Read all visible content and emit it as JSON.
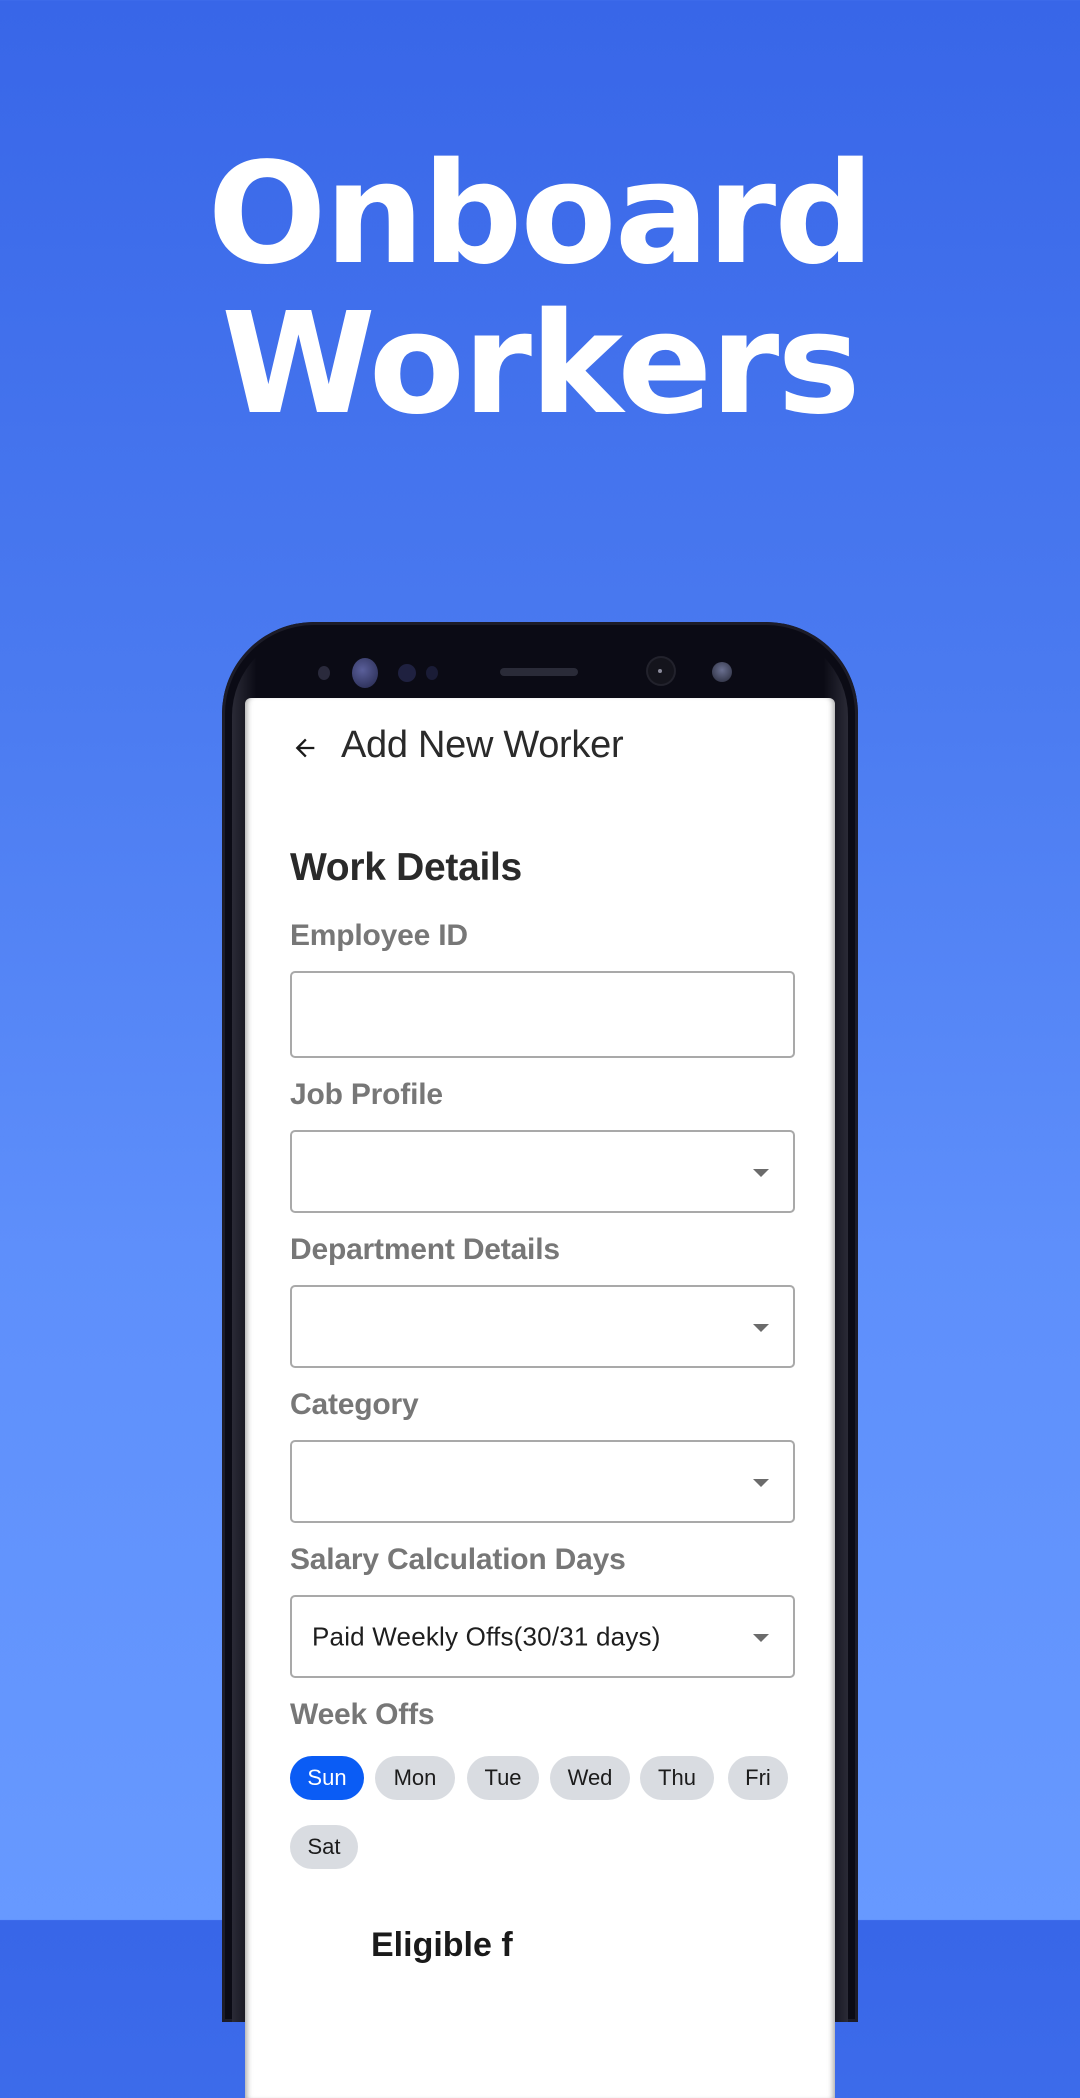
{
  "headline": {
    "line1": "Onboard",
    "line2": "Workers"
  },
  "colors": {
    "background_top": "#3866e8",
    "background_bottom": "#6799ff",
    "accent": "#0a5cf5",
    "chip_inactive": "#d9dce1"
  },
  "app": {
    "back_icon": "arrow-left-icon",
    "title": "Add New Worker"
  },
  "form": {
    "section_title": "Work Details",
    "fields": [
      {
        "label": "Employee ID",
        "type": "text",
        "value": "",
        "placeholder": ""
      },
      {
        "label": "Job Profile",
        "type": "dropdown",
        "value": ""
      },
      {
        "label": "Department Details",
        "type": "dropdown",
        "value": ""
      },
      {
        "label": "Category",
        "type": "dropdown",
        "value": ""
      },
      {
        "label": "Salary Calculation Days",
        "type": "dropdown",
        "value": "Paid Weekly Offs(30/31 days)"
      }
    ],
    "week_offs": {
      "label": "Week Offs",
      "days": [
        {
          "label": "Sun",
          "selected": true
        },
        {
          "label": "Mon",
          "selected": false
        },
        {
          "label": "Tue",
          "selected": false
        },
        {
          "label": "Wed",
          "selected": false
        },
        {
          "label": "Thu",
          "selected": false
        },
        {
          "label": "Fri",
          "selected": false
        },
        {
          "label": "Sat",
          "selected": false
        }
      ]
    },
    "cutoff_text": "Eligible f"
  }
}
